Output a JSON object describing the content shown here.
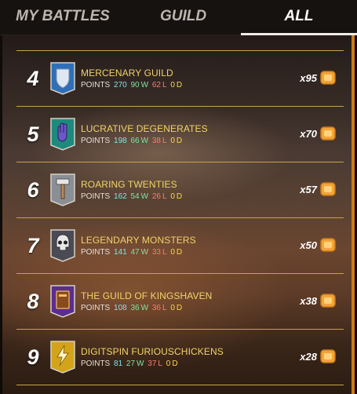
{
  "tabs": [
    {
      "label": "MY BATTLES"
    },
    {
      "label": "GUILD"
    },
    {
      "label": "ALL",
      "active": true
    }
  ],
  "stats_labels": {
    "points": "POINTS",
    "wins_suffix": "W",
    "losses_suffix": "L",
    "draws_suffix": "D"
  },
  "guilds": [
    {
      "rank": "4",
      "name": "MERCENARY GUILD",
      "points": "270",
      "wins": "90",
      "losses": "62",
      "draws": "0",
      "reward": "x95",
      "emblem": "shield-icon",
      "emblem_color": "#2f6fb8"
    },
    {
      "rank": "5",
      "name": "LUCRATIVE DEGENERATES",
      "points": "198",
      "wins": "66",
      "losses": "38",
      "draws": "0",
      "reward": "x70",
      "emblem": "hand-icon",
      "emblem_color": "#1d8a7d"
    },
    {
      "rank": "6",
      "name": "ROARING TWENTIES",
      "points": "162",
      "wins": "54",
      "losses": "26",
      "draws": "0",
      "reward": "x57",
      "emblem": "hammer-icon",
      "emblem_color": "#8a8f96"
    },
    {
      "rank": "7",
      "name": "LEGENDARY MONSTERS",
      "points": "141",
      "wins": "47",
      "losses": "33",
      "draws": "0",
      "reward": "x50",
      "emblem": "skull-icon",
      "emblem_color": "#4b4b55"
    },
    {
      "rank": "8",
      "name": "THE GUILD OF KINGSHAVEN",
      "points": "108",
      "wins": "36",
      "losses": "36",
      "draws": "0",
      "reward": "x38",
      "emblem": "book-icon",
      "emblem_color": "#5b2d8f"
    },
    {
      "rank": "9",
      "name": "DIGITSPIN FURIOUSCHICKENS",
      "points": "81",
      "wins": "27",
      "losses": "37",
      "draws": "0",
      "reward": "x28",
      "emblem": "lightning-icon",
      "emblem_color": "#d3a319"
    }
  ],
  "colors": {
    "accent": "#f1d36a",
    "scrollbar": "#d07a18",
    "reward_icon": "#f2a43a"
  }
}
